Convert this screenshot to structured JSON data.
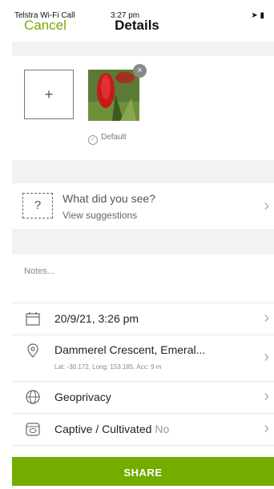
{
  "status_bar": {
    "carrier": "Telstra Wi-Fi Call",
    "time": "3:27 pm",
    "right_icons": "location-arrow-icon battery-icon"
  },
  "nav": {
    "cancel_label": "Cancel",
    "title": "Details"
  },
  "photos": {
    "add_label": "+",
    "remove_label": "×",
    "default_label": "Default",
    "default_check": "✓"
  },
  "species": {
    "icon_glyph": "?",
    "title": "What did you see?",
    "subtitle": "View suggestions"
  },
  "notes": {
    "placeholder": "Notes..."
  },
  "date_row": {
    "text": "20/9/21, 3:26 pm"
  },
  "location_row": {
    "text": "Dammerel Crescent, Emeral...",
    "details": "Lat: -30.172, Long: 153.185, Acc: 9 m"
  },
  "geoprivacy_row": {
    "text": "Geoprivacy"
  },
  "captive_row": {
    "text": "Captive / Cultivated",
    "value": "No"
  },
  "chevron": "›",
  "share_label": "SHARE",
  "colors": {
    "accent": "#74ac00",
    "band": "#f2f2f2"
  }
}
